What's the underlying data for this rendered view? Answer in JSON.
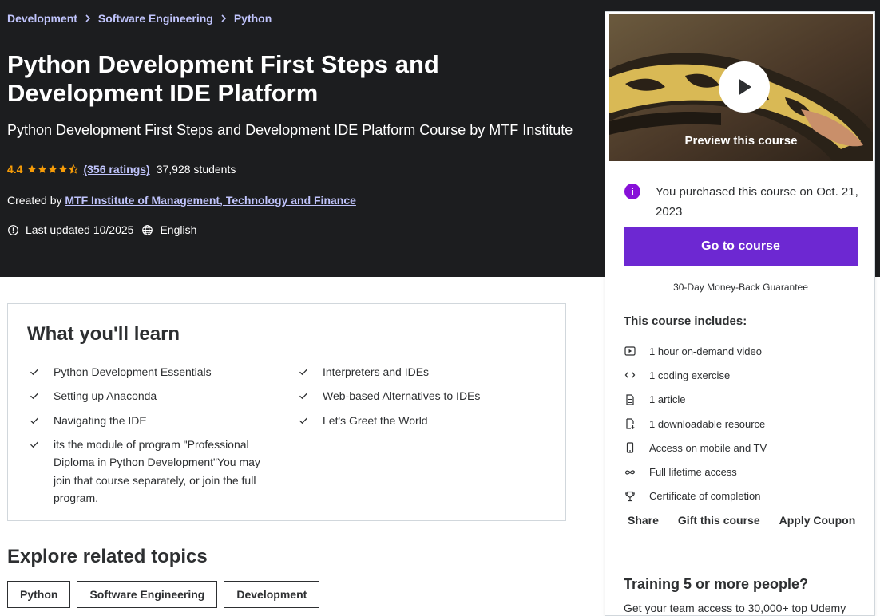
{
  "breadcrumb": [
    "Development",
    "Software Engineering",
    "Python"
  ],
  "course": {
    "title": "Python Development First Steps and Development IDE Platform",
    "subtitle": "Python Development First Steps and Development IDE Platform Course by MTF Institute",
    "rating": "4.4",
    "stars_filled": 4.5,
    "ratings_count": "(356 ratings)",
    "students": "37,928 students",
    "created_by_label": "Created by",
    "creator": "MTF Institute of Management, Technology and Finance",
    "last_updated": "Last updated 10/2025",
    "language": "English"
  },
  "sidebar": {
    "preview_label": "Preview this course",
    "purchased_text": "You purchased this course on Oct. 21, 2023",
    "go_button": "Go to course",
    "guarantee": "30-Day Money-Back Guarantee",
    "includes_title": "This course includes:",
    "includes": [
      {
        "icon": "video-icon",
        "text": "1 hour on-demand video"
      },
      {
        "icon": "code-icon",
        "text": "1 coding exercise"
      },
      {
        "icon": "article-icon",
        "text": "1 article"
      },
      {
        "icon": "download-file-icon",
        "text": "1 downloadable resource"
      },
      {
        "icon": "mobile-icon",
        "text": "Access on mobile and TV"
      },
      {
        "icon": "infinity-icon",
        "text": "Full lifetime access"
      },
      {
        "icon": "trophy-icon",
        "text": "Certificate of completion"
      }
    ],
    "links": {
      "share": "Share",
      "gift": "Gift this course",
      "coupon": "Apply Coupon"
    },
    "training_title": "Training 5 or more people?",
    "training_text": "Get your team access to 30,000+ top Udemy"
  },
  "learn": {
    "title": "What you'll learn",
    "left": [
      "Python Development Essentials",
      "Setting up Anaconda",
      "Navigating the IDE",
      "its the module of program \"Professional Diploma in Python Development\"You may join that course separately, or join the full program."
    ],
    "right": [
      "Interpreters and IDEs",
      "Web-based Alternatives to IDEs",
      "Let's Greet the World"
    ]
  },
  "explore": {
    "title": "Explore related topics",
    "topics": [
      "Python",
      "Software Engineering",
      "Development"
    ]
  },
  "colors": {
    "hero_bg": "#1c1d1f",
    "link_purple": "#c0c4fc",
    "rating_orange": "#f69c08",
    "button_purple": "#6d28d2",
    "info_purple": "#8710d8"
  }
}
